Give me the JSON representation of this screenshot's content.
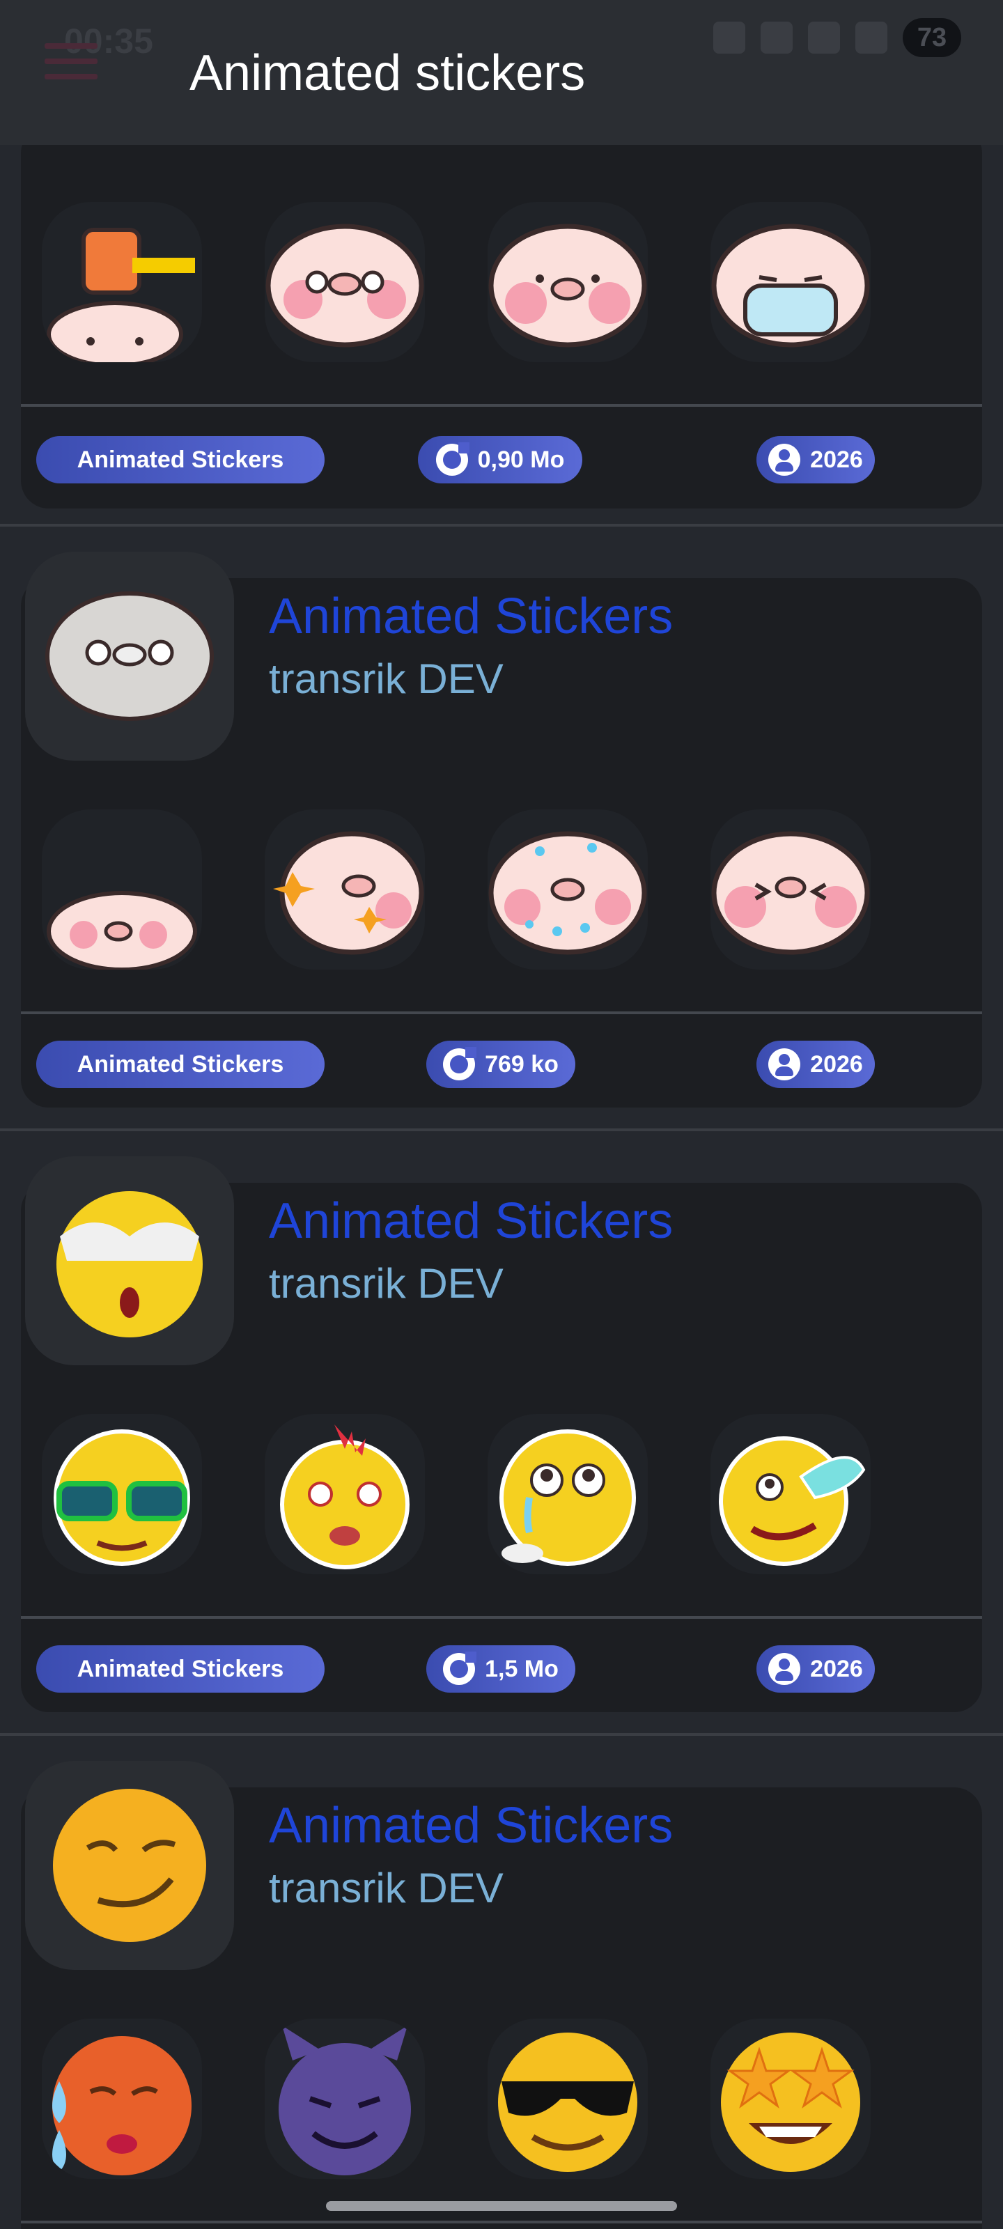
{
  "status_bar": {
    "time": "00:35",
    "battery": "73"
  },
  "app_bar": {
    "title": "Animated stickers"
  },
  "packs": [
    {
      "title": "",
      "author": "",
      "category": "Animated Stickers",
      "size": "0,90 Mo",
      "year": "2026",
      "thumb": "",
      "stickers": [
        "pig-hammer",
        "pig-eyes",
        "pig-worried",
        "pig-mask"
      ]
    },
    {
      "title": "Animated Stickers",
      "author": "transrik DEV",
      "category": "Animated Stickers",
      "size": "769 ko",
      "year": "2026",
      "thumb": "pig-blur",
      "stickers": [
        "pig-peek",
        "pig-sparkle",
        "pig-sweat",
        "pig-squint"
      ]
    },
    {
      "title": "Animated Stickers",
      "author": "transrik DEV",
      "category": "Animated Stickers",
      "size": "1,5 Mo",
      "year": "2026",
      "thumb": "emoji-sunglasses-up",
      "stickers": [
        "emoji-green-glasses",
        "emoji-rooster-angry",
        "emoji-crying",
        "emoji-wink-tongue"
      ]
    },
    {
      "title": "Animated Stickers",
      "author": "transrik DEV",
      "category": "",
      "size": "",
      "year": "",
      "thumb": "emoji-smirk",
      "stickers": [
        "emoji-sweat-face",
        "emoji-smiling-devil",
        "emoji-sunglasses",
        "emoji-star-struck"
      ]
    }
  ]
}
